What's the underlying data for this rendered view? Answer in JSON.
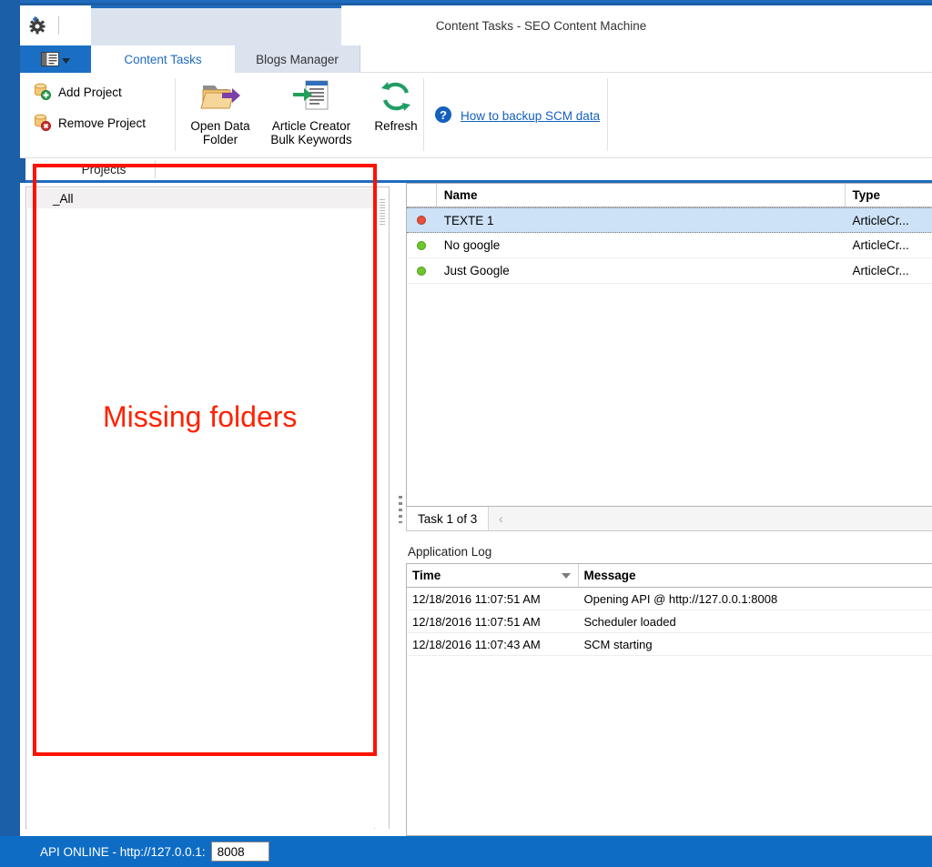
{
  "window": {
    "title": "Content Tasks - SEO Content Machine"
  },
  "quick_access": {
    "settings_icon": "gear-icon"
  },
  "app_menu": {
    "icon": "panel-layout-icon",
    "dropdown_icon": "chevron-down-icon"
  },
  "ribbon": {
    "tabs": [
      {
        "label": "Content Tasks",
        "active": true
      },
      {
        "label": "Blogs Manager",
        "active": false
      }
    ],
    "small_buttons": [
      {
        "label": "Add Project",
        "icon": "database-add-icon"
      },
      {
        "label": "Remove Project",
        "icon": "database-remove-icon"
      }
    ],
    "big_buttons": [
      {
        "label": "Open Data\nFolder",
        "icon": "open-folder-arrow-icon"
      },
      {
        "label": "Article Creator\nBulk Keywords",
        "icon": "document-import-icon"
      },
      {
        "label": "Refresh",
        "icon": "refresh-icon"
      }
    ],
    "help": {
      "icon": "help-question-icon",
      "link_label": "How to backup SCM data"
    }
  },
  "subtab": {
    "label": "Projects"
  },
  "projects_panel": {
    "items": [
      {
        "label": "_All",
        "selected": true
      }
    ]
  },
  "task_grid": {
    "columns": [
      "",
      "Name",
      "Type"
    ],
    "rows": [
      {
        "status": "red",
        "name": "TEXTE 1",
        "type": "ArticleCr...",
        "selected": true
      },
      {
        "status": "green",
        "name": "No google",
        "type": "ArticleCr...",
        "selected": false
      },
      {
        "status": "green",
        "name": "Just Google",
        "type": "ArticleCr...",
        "selected": false
      }
    ],
    "tab_label": "Task 1 of 3",
    "prev_icon": "chevron-left-icon"
  },
  "application_log": {
    "label": "Application Log",
    "columns": [
      "Time",
      "Message"
    ],
    "sort_icon": "sort-descending-icon",
    "rows": [
      {
        "time": "12/18/2016 11:07:51 AM",
        "message": "Opening API @ http://127.0.0.1:8008"
      },
      {
        "time": "12/18/2016 11:07:51 AM",
        "message": "Scheduler loaded"
      },
      {
        "time": "12/18/2016 11:07:43 AM",
        "message": "SCM starting"
      }
    ]
  },
  "statusbar": {
    "text": "API ONLINE - http://127.0.0.1:",
    "port": "8008"
  },
  "annotation": {
    "label": "Missing folders",
    "color": "#ff2200"
  },
  "colors": {
    "accent_blue": "#1f6bbd",
    "status_blue": "#0f6cc4",
    "selection_blue": "#cde2f7",
    "link_blue": "#1560bd",
    "status_red": "#e8503a",
    "status_green": "#6ec82a",
    "annotation_red": "#ff1100"
  }
}
